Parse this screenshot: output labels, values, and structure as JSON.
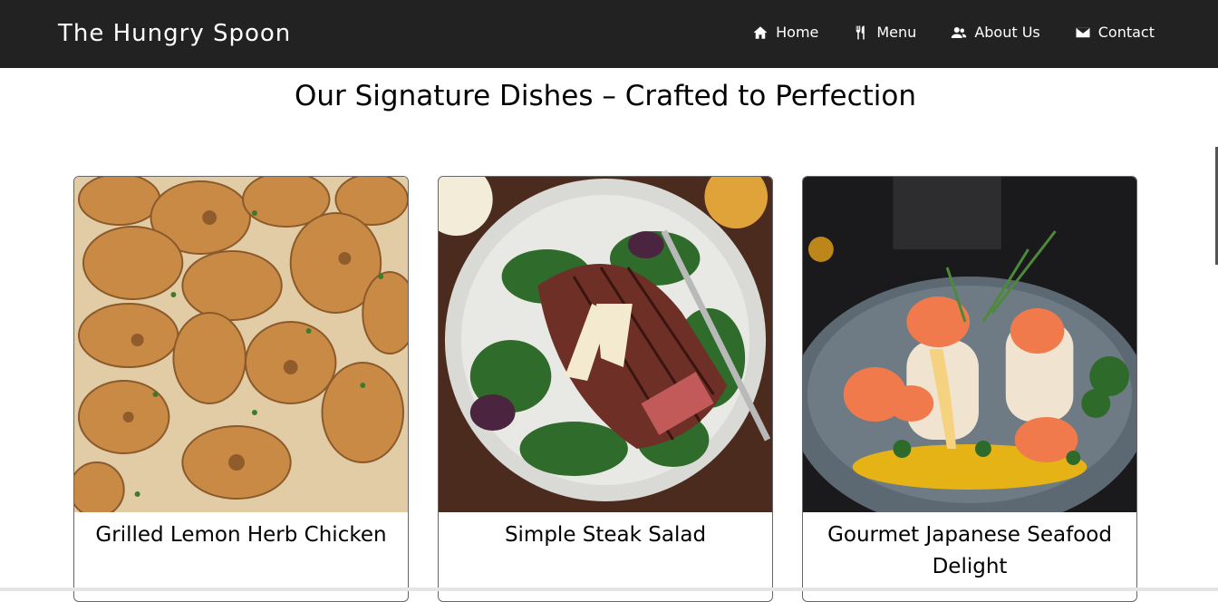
{
  "header": {
    "brand": "The Hungry Spoon",
    "nav": [
      {
        "label": "Home",
        "icon": "home-icon"
      },
      {
        "label": "Menu",
        "icon": "utensils-icon"
      },
      {
        "label": "About Us",
        "icon": "users-icon"
      },
      {
        "label": "Contact",
        "icon": "envelope-icon"
      }
    ]
  },
  "main": {
    "title": "Our Signature Dishes – Crafted to Perfection",
    "dishes": [
      {
        "name": "Grilled Lemon Herb Chicken"
      },
      {
        "name": "Simple Steak Salad"
      },
      {
        "name": "Gourmet Japanese Seafood Delight"
      }
    ]
  },
  "colors": {
    "navbar_bg": "#222222",
    "text": "#000000"
  }
}
